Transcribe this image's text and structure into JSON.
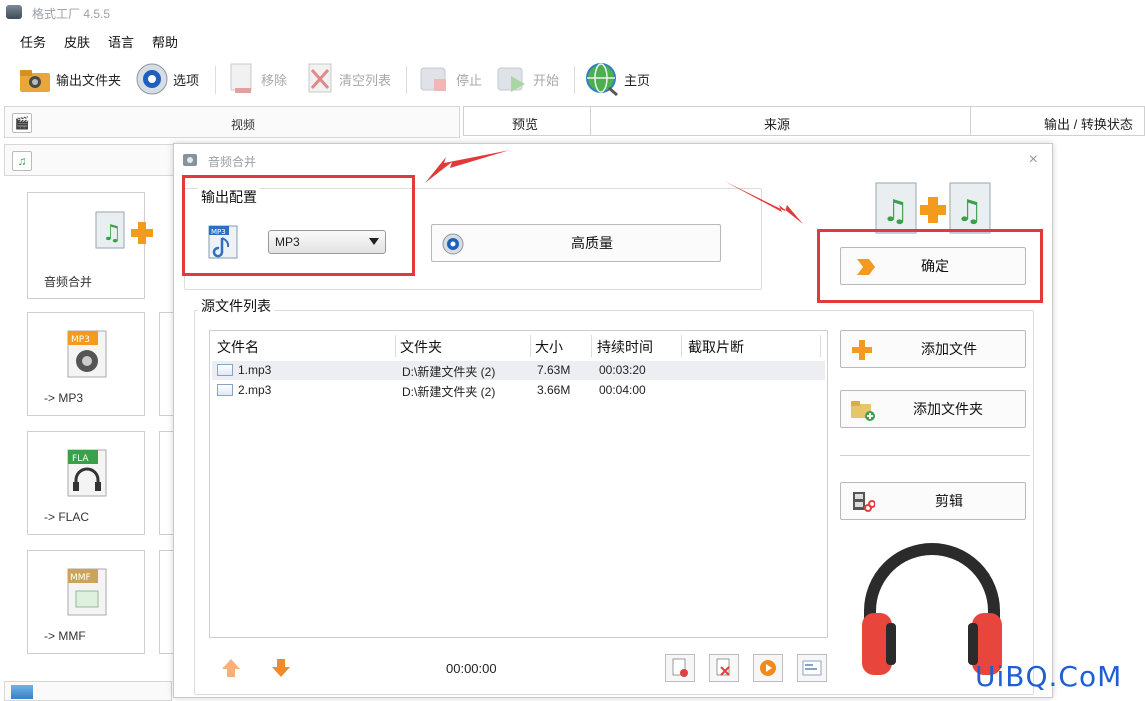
{
  "window": {
    "title": "格式工厂 4.5.5"
  },
  "menubar": {
    "items": [
      "任务",
      "皮肤",
      "语言",
      "帮助"
    ]
  },
  "toolbar": {
    "output_folder": "输出文件夹",
    "options": "选项",
    "remove": "移除",
    "clear_list": "清空列表",
    "stop": "停止",
    "start": "开始",
    "home": "主页"
  },
  "left_panel": {
    "video_category": "视频",
    "tiles": {
      "audio_merge": "音频合并",
      "mp3": "-> MP3",
      "flac": "-> FLAC",
      "mmf": "-> MMF"
    },
    "tile_badges": {
      "mp3": "MP3",
      "flac": "FLA",
      "mmf": "MMF"
    }
  },
  "task_table": {
    "headers": [
      "预览",
      "来源",
      "输出 / 转换状态"
    ]
  },
  "dialog": {
    "title": "音频合并",
    "close_glyph": "×",
    "output_config": {
      "group_label": "输出配置",
      "format_value": "MP3",
      "format_icon_text": "MP3",
      "quality_button": "高质量"
    },
    "ok_button": "确定",
    "source_list": {
      "group_label": "源文件列表",
      "columns": [
        "文件名",
        "文件夹",
        "大小",
        "持续时间",
        "截取片断"
      ],
      "rows": [
        {
          "name": "1.mp3",
          "folder": "D:\\新建文件夹 (2)",
          "size": "7.63M",
          "duration": "00:03:20",
          "clip": ""
        },
        {
          "name": "2.mp3",
          "folder": "D:\\新建文件夹 (2)",
          "size": "3.66M",
          "duration": "00:04:00",
          "clip": ""
        }
      ],
      "total_time": "00:00:00"
    },
    "add_file_button": "添加文件",
    "add_folder_button": "添加文件夹",
    "edit_button": "剪辑"
  },
  "watermark": "UiBQ.CoM",
  "colors": {
    "annotation_red": "#e23a3a",
    "headphone_red": "#e8453c",
    "accent_orange": "#f39a1f",
    "watermark_blue": "#1e5fd6"
  }
}
